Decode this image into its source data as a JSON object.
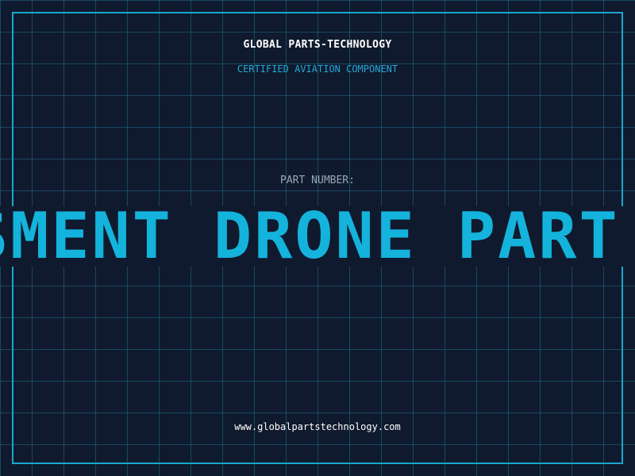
{
  "header": {
    "company": "GLOBAL PARTS-TECHNOLOGY",
    "subtitle": "CERTIFIED AVIATION COMPONENT"
  },
  "part": {
    "label": "PART NUMBER:",
    "value_visible": "SMENT DRONE PART LO"
  },
  "footer": {
    "url": "www.globalpartstechnology.com"
  },
  "colors": {
    "background": "#101a2e",
    "grid": "#1e6e8c",
    "frame": "#19a7cf",
    "accent": "#14b3dc"
  }
}
